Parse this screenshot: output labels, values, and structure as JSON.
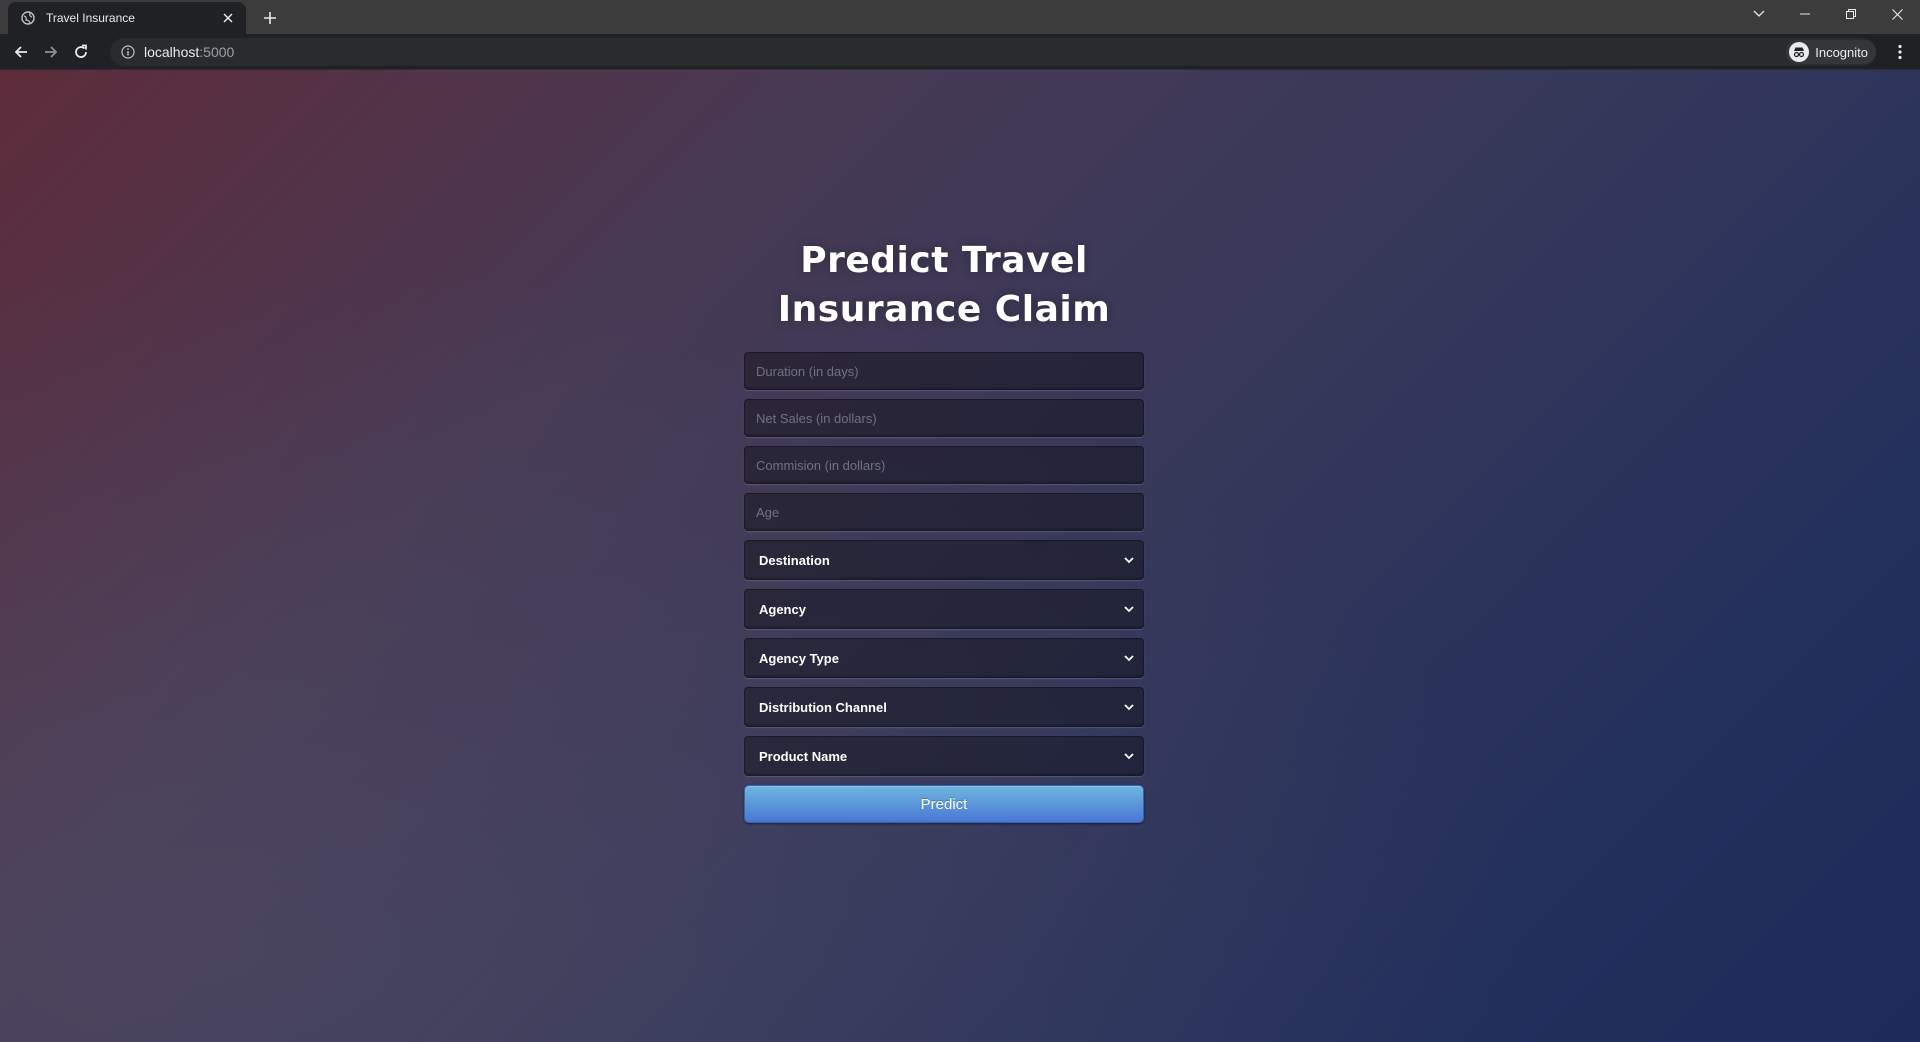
{
  "browser": {
    "tab": {
      "title": "Travel Insurance",
      "favicon": "globe-icon"
    },
    "address_bar": {
      "host": "localhost",
      "port": ":5000"
    },
    "profile": {
      "label": "Incognito"
    }
  },
  "page": {
    "title_line1": "Predict Travel",
    "title_line2": "Insurance Claim",
    "fields": {
      "duration": {
        "placeholder": "Duration (in days)",
        "value": ""
      },
      "net_sales": {
        "placeholder": "Net Sales (in dollars)",
        "value": ""
      },
      "commision": {
        "placeholder": "Commision (in dollars)",
        "value": ""
      },
      "age": {
        "placeholder": "Age",
        "value": ""
      }
    },
    "selects": {
      "destination": "Destination",
      "agency": "Agency",
      "agency_type": "Agency Type",
      "distribution_channel": "Distribution Channel",
      "product_name": "Product Name"
    },
    "predict_label": "Predict"
  },
  "colors": {
    "button_top": "#6eb6de",
    "button_bottom": "#4a77d4",
    "background_left": "#5e2c3b",
    "background_right": "#1c2b58"
  }
}
